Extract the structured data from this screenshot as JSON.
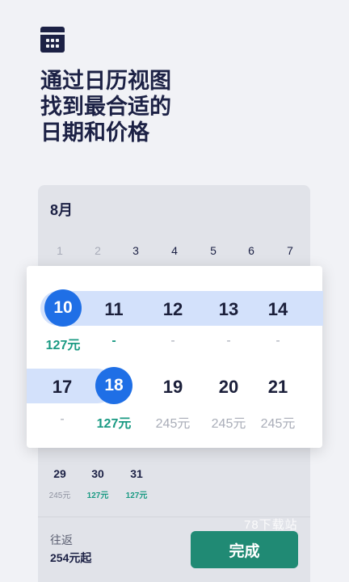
{
  "headline": {
    "line1": "通过日历视图",
    "line2": "找到最合适的",
    "line3": "日期和价格"
  },
  "icons": {
    "header": "calendar-icon"
  },
  "calendar": {
    "month": "8月",
    "weekday_numbers": [
      "1",
      "2",
      "3",
      "4",
      "5",
      "6",
      "7"
    ],
    "row1": {
      "days": [
        "10",
        "11",
        "12",
        "13",
        "14"
      ],
      "prices": [
        "127元",
        "-",
        "-",
        "-",
        "-"
      ]
    },
    "row2": {
      "days": [
        "17",
        "18",
        "19",
        "20",
        "21"
      ],
      "prices": [
        "-",
        "127元",
        "245元",
        "245元",
        "245元"
      ]
    },
    "row3": {
      "days": [
        "29",
        "30",
        "31"
      ],
      "prices": [
        "245元",
        "127元",
        "127元"
      ]
    }
  },
  "footer": {
    "trip_type": "往返",
    "from_price": "254元起",
    "done_label": "完成"
  },
  "watermark": "78下载站",
  "colors": {
    "selected": "#1f6fe6",
    "range_band": "#d3e1fb",
    "price_low": "#1a9a83",
    "button": "#208a74"
  }
}
